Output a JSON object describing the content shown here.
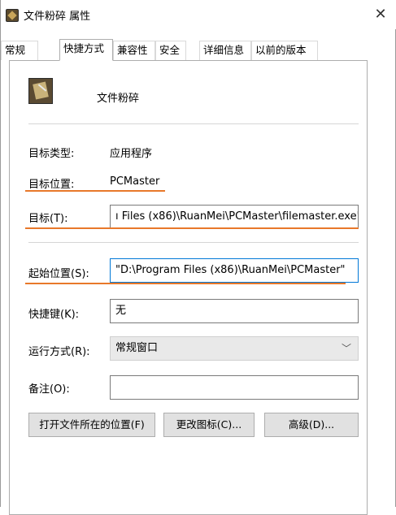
{
  "window": {
    "title": "文件粉碎 属性",
    "close_glyph": "✕"
  },
  "tabs": [
    {
      "label": "常规"
    },
    {
      "label": "快捷方式"
    },
    {
      "label": "兼容性"
    },
    {
      "label": "安全"
    },
    {
      "label": "详细信息"
    },
    {
      "label": "以前的版本"
    }
  ],
  "active_tab": "快捷方式",
  "shortcut": {
    "name": "文件粉碎",
    "icon": "file-shredder-icon",
    "target_type_label": "目标类型:",
    "target_type_value": "应用程序",
    "target_location_label": "目标位置:",
    "target_location_value": "PCMaster",
    "target_label": "目标(T):",
    "target_value": "ı Files (x86)\\RuanMei\\PCMaster\\filemaster.exe\"",
    "start_in_label": "起始位置(S):",
    "start_in_value": "\"D:\\Program Files (x86)\\RuanMei\\PCMaster\"",
    "hotkey_label": "快捷键(K):",
    "hotkey_value": "无",
    "run_label": "运行方式(R):",
    "run_value": "常规窗口",
    "comment_label": "备注(O):",
    "comment_value": ""
  },
  "buttons": {
    "open_location": "打开文件所在的位置(F)",
    "change_icon": "更改图标(C)...",
    "advanced": "高级(D)..."
  },
  "colors": {
    "highlight_underline": "#e8782a",
    "focus_border": "#0078d7"
  }
}
